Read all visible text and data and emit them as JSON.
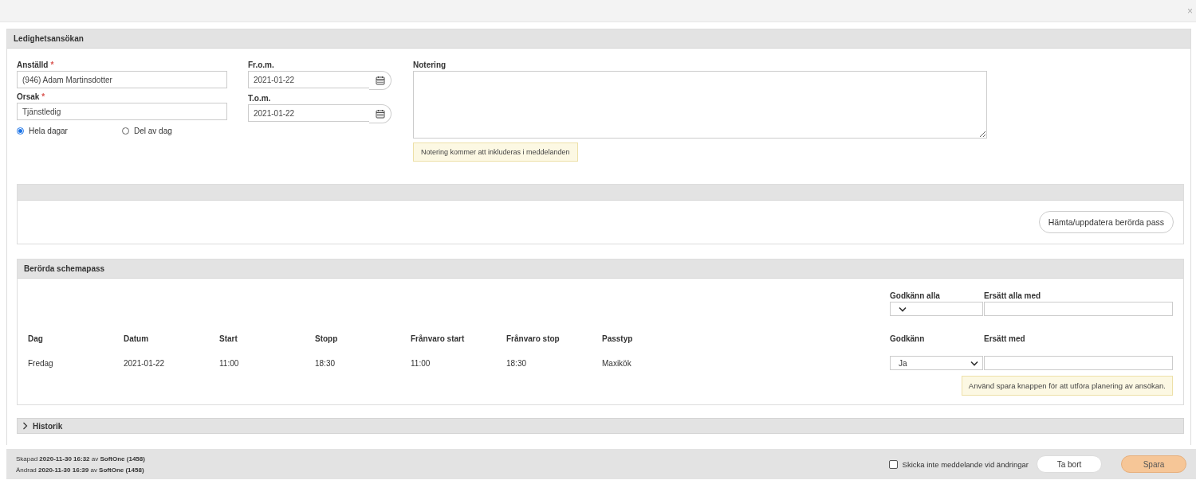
{
  "dialog": {
    "close": "×"
  },
  "panel": {
    "title": "Ledighetsansökan"
  },
  "form": {
    "employee": {
      "label": "Anställd",
      "required_mark": "*",
      "value": "(946) Adam Martinsdotter"
    },
    "reason": {
      "label": "Orsak",
      "required_mark": "*",
      "value": "Tjänstledig"
    },
    "from": {
      "label": "Fr.o.m.",
      "value": "2021-01-22"
    },
    "to": {
      "label": "T.o.m.",
      "value": "2021-01-22"
    },
    "day_options": [
      {
        "label": "Hela dagar",
        "selected": true
      },
      {
        "label": "Del av dag",
        "selected": false
      }
    ],
    "note": {
      "label": "Notering",
      "hint": "Notering kommer att inkluderas i meddelanden"
    }
  },
  "fetch_section": {
    "button": "Hämta/uppdatera berörda pass"
  },
  "affected_shifts": {
    "title": "Berörda schemapass",
    "approve_all": {
      "label": "Godkänn alla"
    },
    "replace_all": {
      "label": "Ersätt alla med"
    },
    "columns": [
      "Dag",
      "Datum",
      "Start",
      "Stopp",
      "Frånvaro start",
      "Frånvaro stop",
      "Passtyp"
    ],
    "approve_column": "Godkänn",
    "replace_column": "Ersätt med",
    "rows": [
      {
        "cells": [
          "Fredag",
          "2021-01-22",
          "11:00",
          "18:30",
          "11:00",
          "18:30",
          "Maxikök"
        ],
        "approve": "Ja"
      }
    ],
    "hint": "Använd spara knappen för att utföra planering av ansökan."
  },
  "history": {
    "title": "Historik",
    "expanded": false
  },
  "footer": {
    "created": "Skapad **2020-11-30 16:32** av **SoftOne (1458)**",
    "changed": "Ändrad **2020-11-30 16:39** av **SoftOne (1458)**",
    "no_message": {
      "label": "Skicka inte meddelande vid ändringar",
      "checked": false
    },
    "buttons": [
      {
        "label": "Ta bort",
        "kind": "secondary"
      },
      {
        "label": "Spara",
        "kind": "primary"
      }
    ]
  }
}
